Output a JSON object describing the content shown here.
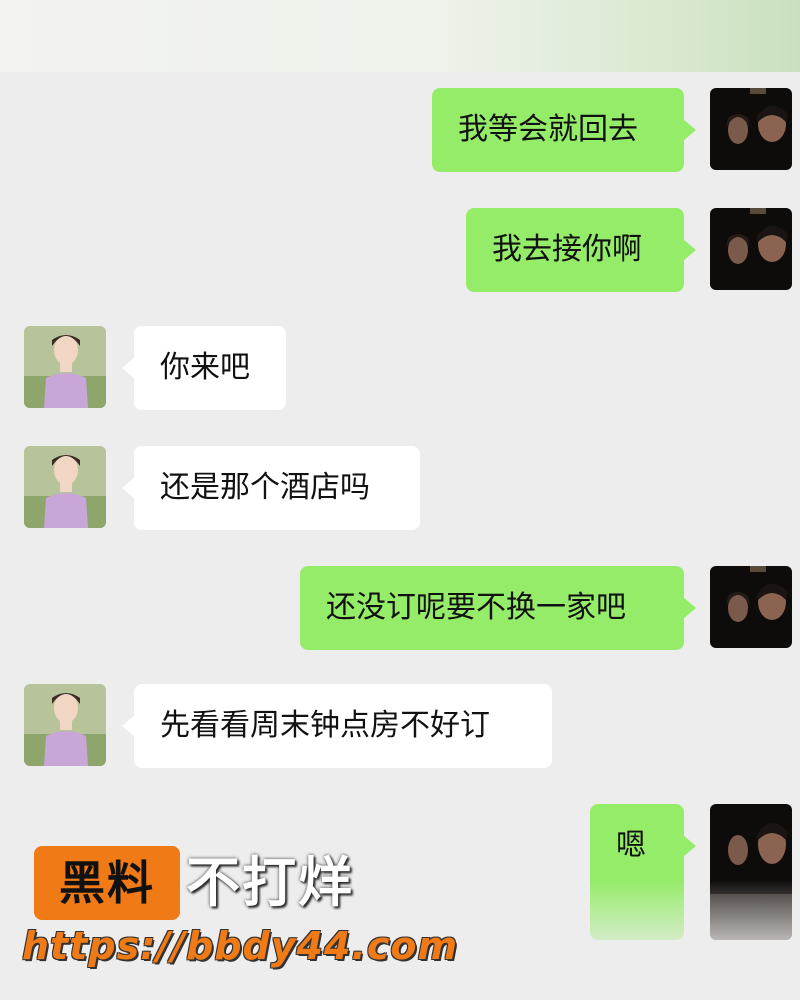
{
  "messages": [
    {
      "side": "right",
      "text": "我等会就回去",
      "avatar": "male-avatar"
    },
    {
      "side": "right",
      "text": "我去接你啊",
      "avatar": "male-avatar"
    },
    {
      "side": "left",
      "text": "你来吧",
      "avatar": "female-avatar"
    },
    {
      "side": "left",
      "text": "还是那个酒店吗",
      "avatar": "female-avatar"
    },
    {
      "side": "right",
      "text": "还没订呢要不换一家吧",
      "avatar": "male-avatar"
    },
    {
      "side": "left",
      "text": "先看看周末钟点房不好订",
      "avatar": "female-avatar"
    },
    {
      "side": "right",
      "text": "嗯",
      "avatar": "male-avatar"
    }
  ],
  "watermark": {
    "badge": "黑料",
    "slogan": "不打烊",
    "url": "https://bbdy44.com"
  },
  "colors": {
    "background": "#ededed",
    "sent_bubble": "#95ec69",
    "received_bubble": "#ffffff",
    "watermark_orange": "#f07a16"
  }
}
